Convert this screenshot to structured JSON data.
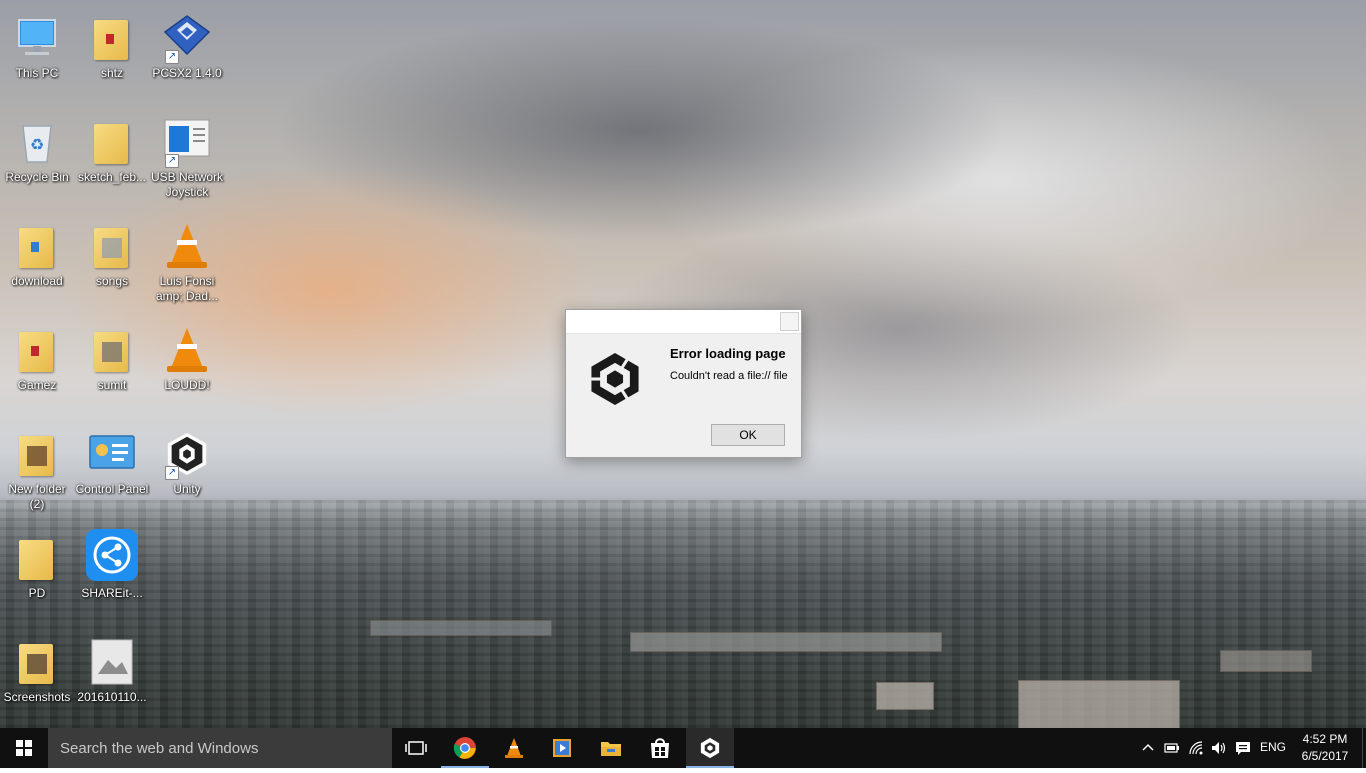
{
  "desktop": {
    "icons": [
      {
        "label": "This PC",
        "icon": "computer-icon"
      },
      {
        "label": "shtz",
        "icon": "folder-icon"
      },
      {
        "label": "PCSX2 1.4.0",
        "icon": "pcsx2-icon"
      },
      {
        "label": "Recycle Bin",
        "icon": "recycle-bin-icon"
      },
      {
        "label": "sketch_feb...",
        "icon": "folder-icon"
      },
      {
        "label": "USB Network Joystick",
        "icon": "usb-joystick-icon"
      },
      {
        "label": "download",
        "icon": "folder-icon"
      },
      {
        "label": "songs",
        "icon": "folder-icon"
      },
      {
        "label": "Luis Fonsi amp; Dad...",
        "icon": "vlc-icon"
      },
      {
        "label": "Gamez",
        "icon": "folder-icon"
      },
      {
        "label": "sumit",
        "icon": "folder-icon"
      },
      {
        "label": "LOUDD!",
        "icon": "vlc-icon"
      },
      {
        "label": "New folder (2)",
        "icon": "folder-icon"
      },
      {
        "label": "Control Panel",
        "icon": "control-panel-icon"
      },
      {
        "label": "Unity",
        "icon": "unity-icon"
      },
      {
        "label": "PD",
        "icon": "folder-icon"
      },
      {
        "label": "SHAREit-...",
        "icon": "shareit-icon"
      },
      {
        "label": "Screenshots",
        "icon": "folder-icon"
      },
      {
        "label": "201610110...",
        "icon": "image-file-icon"
      }
    ]
  },
  "dialog": {
    "title": "Error loading page",
    "message": "Couldn't read a file:// file",
    "ok_label": "OK"
  },
  "taskbar": {
    "search_placeholder": "Search the web and Windows",
    "pinned": [
      "task-view-icon",
      "chrome-icon",
      "vlc-icon",
      "media-player-icon",
      "file-explorer-icon",
      "store-icon",
      "unity-icon"
    ],
    "tray": {
      "language": "ENG",
      "time": "4:52 PM",
      "date": "6/5/2017"
    }
  },
  "colors": {
    "taskbar_bg": "#101010",
    "search_bg": "#3b3b3b",
    "accent": "#8ab4e6",
    "dialog_bg": "#f0f0f0"
  }
}
